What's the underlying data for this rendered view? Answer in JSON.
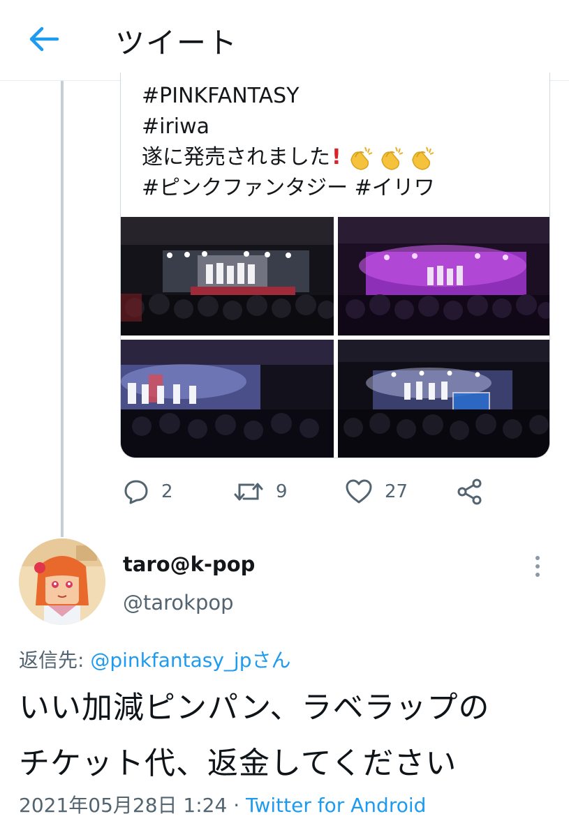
{
  "header": {
    "title": "ツイート"
  },
  "quoted_tweet": {
    "lines": [
      "#PINKFANTASY",
      "#iriwa",
      "遂に発売されました",
      "#ピンクファンタジー #イリワ"
    ],
    "emoji": [
      "red-exclamation",
      "clapping-hands",
      "clapping-hands",
      "clapping-hands"
    ],
    "photos": [
      {
        "name": "stage-photo-1",
        "tone": "white-light"
      },
      {
        "name": "stage-photo-2",
        "tone": "purple-light"
      },
      {
        "name": "stage-photo-3",
        "tone": "blue-light"
      },
      {
        "name": "stage-photo-4",
        "tone": "blue-white-light"
      }
    ]
  },
  "actions": {
    "reply_count": "2",
    "retweet_count": "9",
    "like_count": "27"
  },
  "reply": {
    "display_name": "taro@k-pop",
    "handle": "@tarokpop",
    "reply_to_prefix": "返信先: ",
    "reply_to_mention": "@pinkfantasy_jpさん",
    "body_lines": [
      "いい加減ピンパン、ラベラップの",
      "チケット代、返金してください"
    ],
    "timestamp": "2021年05月28日 1:24",
    "separator": " · ",
    "source": "Twitter for Android"
  },
  "colors": {
    "accent": "#1d9bf0",
    "secondary_text": "#536471",
    "border": "#cfd9de"
  }
}
